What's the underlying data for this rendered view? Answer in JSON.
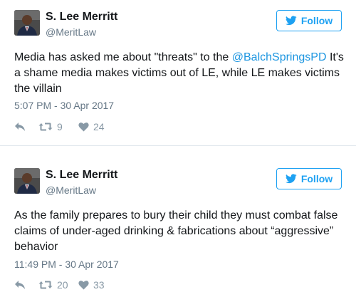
{
  "colors": {
    "accent": "#1da1f2",
    "mention": "#1b95e0",
    "secondary_text": "#657786",
    "action_icon": "#8899a6",
    "divider": "#e1e8ed"
  },
  "tweets": [
    {
      "author_name": "S. Lee Merritt",
      "author_handle": "@MeritLaw",
      "follow_label": "Follow",
      "text_before_mention": "Media has asked me about \"threats\" to the ",
      "mention": "@BalchSpringsPD",
      "text_after_mention": " It's a shame media makes victims out of LE, while LE makes victims the villain",
      "timestamp": "5:07 PM - 30 Apr 2017",
      "retweet_count": "9",
      "like_count": "24",
      "icons": [
        "avatar",
        "twitter-bird-icon",
        "reply-icon",
        "retweet-icon",
        "heart-icon"
      ]
    },
    {
      "author_name": "S. Lee Merritt",
      "author_handle": "@MeritLaw",
      "follow_label": "Follow",
      "text": "As the family prepares to bury their child they must combat false claims of under-aged drinking & fabrications about “aggressive” behavior",
      "timestamp": "11:49 PM - 30 Apr 2017",
      "retweet_count": "20",
      "like_count": "33",
      "icons": [
        "avatar",
        "twitter-bird-icon",
        "reply-icon",
        "retweet-icon",
        "heart-icon"
      ]
    }
  ]
}
